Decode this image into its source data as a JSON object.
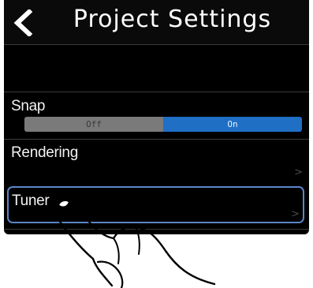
{
  "header": {
    "title": "Project Settings",
    "back_icon": "chevron-left-icon"
  },
  "settings": {
    "snap": {
      "label": "Snap",
      "options": [
        "Off",
        "On"
      ],
      "selected": "On"
    },
    "rendering": {
      "label": "Rendering",
      "chevron": ">"
    },
    "tuner": {
      "label": "Tuner",
      "chevron": ">",
      "highlighted": true
    }
  },
  "colors": {
    "screen_bg": "#000000",
    "toggle_on": "#1f6fc4",
    "toggle_off": "#7a7a7a",
    "highlight_border": "#5a86c8"
  },
  "overlay": {
    "icon": "hand-tap-icon"
  }
}
